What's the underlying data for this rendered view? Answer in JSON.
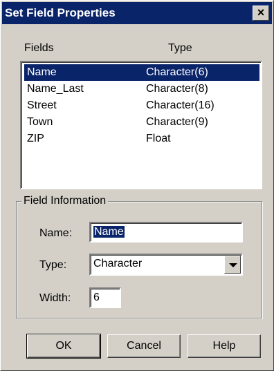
{
  "window": {
    "title": "Set Field Properties",
    "close_glyph": "×"
  },
  "list": {
    "headers": {
      "fields": "Fields",
      "type": "Type"
    },
    "rows": [
      {
        "field": "Name",
        "type": "Character(6)",
        "selected": true
      },
      {
        "field": "Name_Last",
        "type": "Character(8)",
        "selected": false
      },
      {
        "field": "Street",
        "type": "Character(16)",
        "selected": false
      },
      {
        "field": "Town",
        "type": "Character(9)",
        "selected": false
      },
      {
        "field": "ZIP",
        "type": "Float",
        "selected": false
      }
    ]
  },
  "field_info": {
    "legend": "Field Information",
    "name_label": "Name:",
    "name_value": "Name",
    "type_label": "Type:",
    "type_value": "Character",
    "width_label": "Width:",
    "width_value": "6"
  },
  "buttons": {
    "ok": "OK",
    "cancel": "Cancel",
    "help": "Help"
  },
  "icons": {
    "close": "close-icon",
    "dropdown": "chevron-down-icon"
  },
  "colors": {
    "titlebar": "#0a246a",
    "selection": "#0a246a",
    "face": "#d4d0c8"
  }
}
